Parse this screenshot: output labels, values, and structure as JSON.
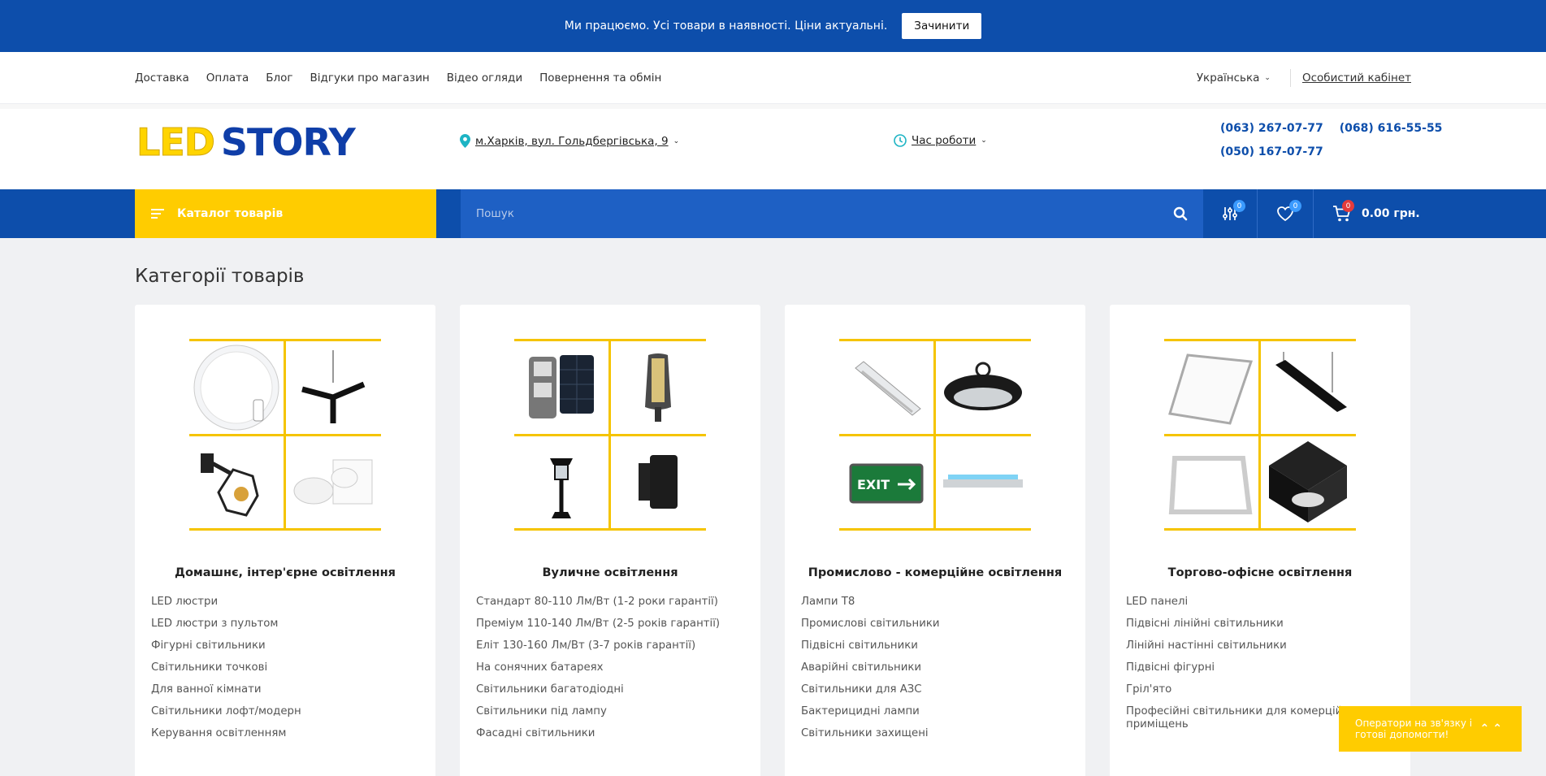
{
  "notice": {
    "text": "Ми працюємо. Усі товари в наявності. Ціни актуальні.",
    "button": "Зачинити"
  },
  "topnav": {
    "links": [
      "Доставка",
      "Оплата",
      "Блог",
      "Відгуки про магазин",
      "Відео огляди",
      "Повернення та обмін"
    ],
    "language": "Українська",
    "cabinet": "Особистий кабінет"
  },
  "header": {
    "logo_led": "LED",
    "logo_story": "STORY",
    "address": "м.Харків, вул. Гольдбергівська, 9",
    "hours": "Час роботи",
    "phones": [
      "(063) 267-07-77",
      "(068) 616-55-55",
      "(050) 167-07-77"
    ]
  },
  "bar": {
    "catalog": "Каталог товарів",
    "search_placeholder": "Пошук",
    "compare_count": "0",
    "wishlist_count": "0",
    "cart_count": "0",
    "cart_total": "0.00 грн."
  },
  "section_title": "Категорії товарів",
  "categories": [
    {
      "title": "Домашнє, інтер'єрне освітлення",
      "items": [
        "LED люстри",
        "LED люстри з пультом",
        "Фігурні світильники",
        "Світильники точкові",
        "Для ванної кімнати",
        "Світильники лофт/модерн",
        "Керування освітленням"
      ]
    },
    {
      "title": "Вуличне освітлення",
      "items": [
        "Стандарт 80-110 Лм/Вт (1-2 роки гарантії)",
        "Преміум 110-140 Лм/Вт (2-5 років гарантії)",
        "Еліт 130-160 Лм/Вт (3-7 років гарантії)",
        "На сонячних батареях",
        "Світильники багатодіодні",
        "Світильники під лампу",
        "Фасадні світильники"
      ]
    },
    {
      "title": "Промислово - комерційне освітлення",
      "items": [
        "Лампи T8",
        "Промислові світильники",
        "Підвісні світильники",
        "Аварійні світильники",
        "Світильники для АЗС",
        "Бактерицидні лампи",
        "Світильники захищені"
      ]
    },
    {
      "title": "Торгово-офісне освітлення",
      "items": [
        "LED панелі",
        "Підвісні лінійні світильники",
        "Лінійні настінні світильники",
        "Підвісні фігурні",
        "Гріл'ято",
        "Професійні світильники для комерційних приміщень"
      ]
    }
  ],
  "chat": {
    "text": "Оператори на зв'язку і готові допомогти!"
  },
  "icons": [
    "map-pin-icon",
    "clock-icon",
    "menu-lines-icon",
    "search-icon",
    "compare-icon",
    "heart-icon",
    "cart-icon",
    "chevron-down-icon"
  ],
  "colors": {
    "brand_blue": "#0d4eab",
    "accent_yellow": "#ffcc00"
  }
}
